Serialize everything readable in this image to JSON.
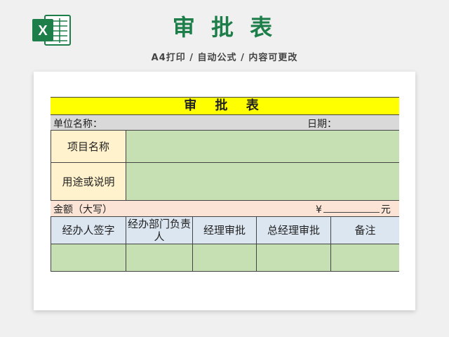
{
  "banner": {
    "title": "审 批 表",
    "subtitle": "A4打印 / 自动公式 / 内容可更改"
  },
  "colors": {
    "brand_green": "#1e7e4a",
    "title_yellow": "#ffff00",
    "field_green": "#c6e0b4",
    "header_blue": "#dce6f1",
    "amount_peach": "#fbe4d5",
    "label_cream": "#fff2cc"
  },
  "logo": {
    "icon": "excel-icon",
    "letter": "X"
  },
  "form": {
    "title": "审 批 表",
    "unit_label": "单位名称：",
    "date_label": "日期：",
    "project_label": "项目名称",
    "purpose_label": "用途或说明",
    "amount_label": "金额（大写）",
    "currency_symbol": "¥",
    "yuan": "元",
    "columns": [
      "经办人签字",
      "经办部门负责人",
      "经理审批",
      "总经理审批",
      "备注"
    ]
  }
}
